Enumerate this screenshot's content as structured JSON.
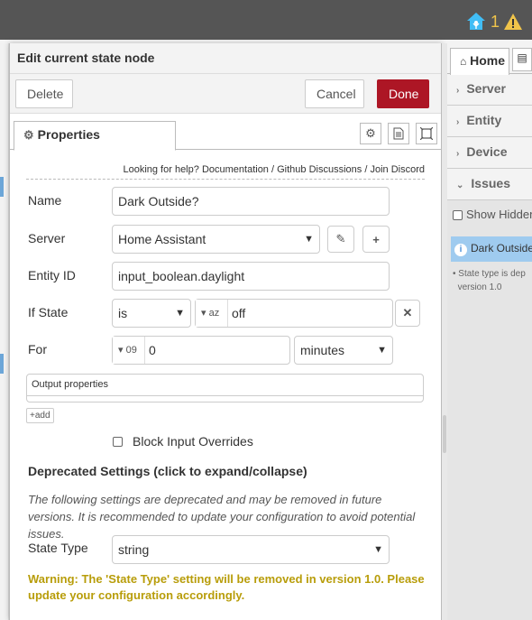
{
  "topbar": {
    "count": "1"
  },
  "tray": {
    "title": "Edit current state node",
    "delete_label": "Delete",
    "cancel_label": "Cancel",
    "done_label": "Done",
    "tab_properties": "Properties"
  },
  "help": {
    "prefix": "Looking for help?",
    "documentation": "Documentation",
    "sep1": "/",
    "github": "Github Discussions",
    "sep2": "/",
    "discord": "Join Discord"
  },
  "form": {
    "name_label": "Name",
    "name_value": "Dark Outside?",
    "server_label": "Server",
    "server_value": "Home Assistant",
    "entity_label": "Entity ID",
    "entity_value": "input_boolean.daylight",
    "ifstate_label": "If State",
    "ifstate_op": "is",
    "ifstate_type": "az",
    "ifstate_value": "off",
    "for_label": "For",
    "for_type": "09",
    "for_value": "0",
    "for_unit": "minutes",
    "output_properties_label": "Output properties",
    "add_label": "add",
    "block_overrides_label": "Block Input Overrides",
    "deprecated_title": "Deprecated Settings (click to expand/collapse)",
    "deprecated_text": "The following settings are deprecated and may be removed in future versions. It is recommended to update your configuration to avoid potential issues.",
    "state_type_label": "State Type",
    "state_type_value": "string",
    "warning_text": "Warning: The 'State Type' setting will be removed in version 1.0. Please update your configuration accordingly."
  },
  "sidebar": {
    "tab_home": "Home",
    "items": [
      {
        "label": "Server",
        "arrow": "›"
      },
      {
        "label": "Entity",
        "arrow": "›"
      },
      {
        "label": "Device",
        "arrow": "›"
      },
      {
        "label": "Issues",
        "arrow": "⌄"
      }
    ],
    "show_hidden": "Show Hidden",
    "issue_node": "Dark Outside?",
    "issue_note_line1": "State type is dep",
    "issue_note_line2": "version 1.0"
  },
  "colors": {
    "done": "#ad1625",
    "warning": "#b89d0a",
    "issue_bg": "#9fcbef",
    "topbar": "#555555"
  }
}
